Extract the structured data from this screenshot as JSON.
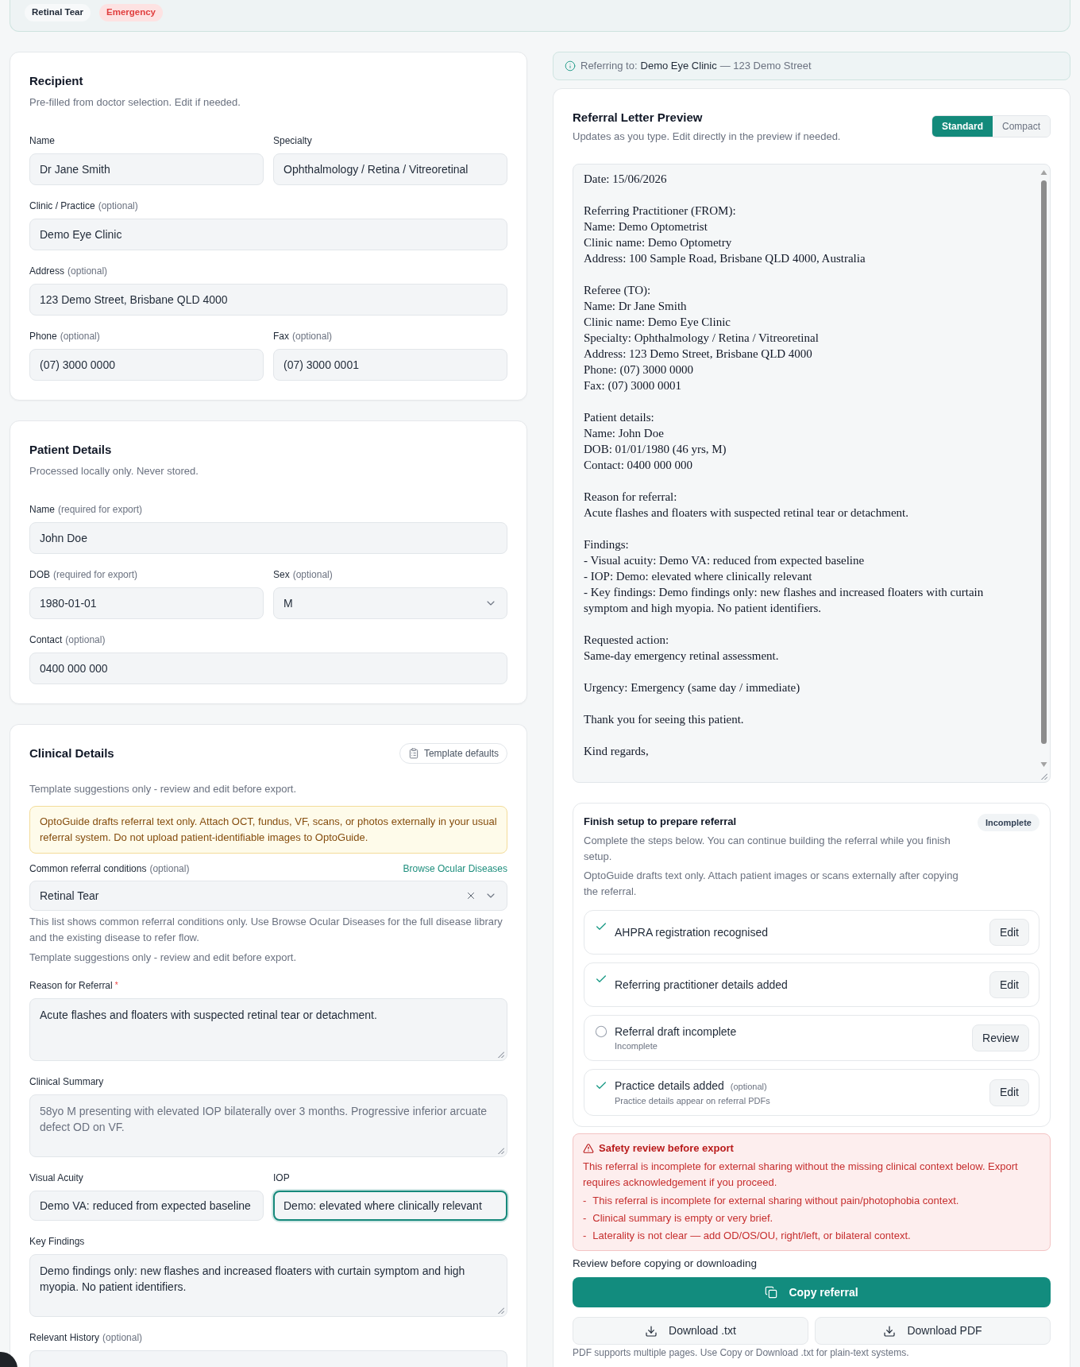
{
  "top_bar": {
    "tags": [
      {
        "kind": "condition",
        "label": "Retinal Tear"
      },
      {
        "kind": "urgency",
        "label": "Emergency"
      }
    ]
  },
  "recipient": {
    "title": "Recipient",
    "subtitle": "Pre-filled from doctor selection. Edit if needed.",
    "rows": [
      [
        {
          "kind": "text",
          "label": "Name",
          "value": "Dr Jane Smith"
        },
        {
          "kind": "text",
          "label": "Specialty",
          "value": "Ophthalmology / Retina / Vitreoretinal"
        }
      ],
      [
        {
          "kind": "text",
          "label": "Clinic / Practice",
          "hint": "(optional)",
          "value": "Demo Eye Clinic"
        }
      ],
      [
        {
          "kind": "text",
          "label": "Address",
          "hint": "(optional)",
          "value": "123 Demo Street, Brisbane QLD 4000"
        }
      ],
      [
        {
          "kind": "text",
          "label": "Phone",
          "hint": "(optional)",
          "value": "(07) 3000 0000"
        },
        {
          "kind": "text",
          "label": "Fax",
          "hint": "(optional)",
          "value": "(07) 3000 0001"
        }
      ]
    ]
  },
  "patient": {
    "title": "Patient Details",
    "subtitle": "Processed locally only. Never stored.",
    "rows": [
      [
        {
          "kind": "text",
          "label": "Name",
          "hint": "(required for export)",
          "value": "John Doe"
        }
      ],
      [
        {
          "kind": "text",
          "label": "DOB",
          "hint": "(required for export)",
          "value": "1980-01-01"
        },
        {
          "kind": "select",
          "label": "Sex",
          "hint": "(optional)",
          "value": "M"
        }
      ],
      [
        {
          "kind": "text",
          "label": "Contact",
          "hint": "(optional)",
          "value": "0400 000 000"
        }
      ]
    ]
  },
  "clinical": {
    "title": "Clinical Details",
    "defaults_button": "Template defaults",
    "subtitle": "Template suggestions only - review and edit before export.",
    "notice": "OptoGuide drafts referral text only. Attach OCT, fundus, VF, scans, or photos externally in your usual referral system. Do not upload patient-identifiable images to OptoGuide.",
    "condition": {
      "label": "Common referral conditions",
      "hint": "(optional)",
      "link": "Browse Ocular Diseases",
      "value": "Retinal Tear",
      "help": "This list shows common referral conditions only. Use Browse Ocular Diseases for the full disease library and the existing disease to refer flow.",
      "note": "Template suggestions only - review and edit before export."
    },
    "rows": [
      [
        {
          "kind": "textarea",
          "label": "Reason for Referral",
          "required_mark": "*",
          "value": "Acute flashes and floaters with suspected retinal tear or detachment.",
          "focused": false
        }
      ],
      [
        {
          "kind": "textarea",
          "label": "Clinical Summary",
          "placeholder": "58yo M presenting with elevated IOP bilaterally over 3 months. Progressive inferior arcuate defect OD on VF.",
          "focused": false
        }
      ],
      [
        {
          "kind": "text",
          "label": "Visual Acuity",
          "value": "Demo VA: reduced from expected baseline",
          "focused": false
        },
        {
          "kind": "text",
          "label": "IOP",
          "value": "Demo: elevated where clinically relevant",
          "focused": true
        }
      ],
      [
        {
          "kind": "textarea",
          "label": "Key Findings",
          "value": "Demo findings only: new flashes and increased floaters with curtain symptom and high myopia. No patient identifiers.",
          "focused": false
        }
      ],
      [
        {
          "kind": "text",
          "label": "Relevant History",
          "hint": "(optional)",
          "focused": false
        }
      ]
    ]
  },
  "banner": {
    "label": "Referring to:",
    "clinic": "Demo Eye Clinic",
    "address": "— 123 Demo Street"
  },
  "preview": {
    "title": "Referral Letter Preview",
    "subtitle": "Updates as you type. Edit directly in the preview if needed.",
    "modes": [
      {
        "label": "Standard",
        "selected": true
      },
      {
        "label": "Compact",
        "selected": false
      }
    ],
    "letter": [
      [
        "Date: 15/06/2026"
      ],
      [
        "Referring Practitioner (FROM):",
        "Name: Demo Optometrist",
        "Clinic name: Demo Optometry",
        "Address: 100 Sample Road, Brisbane QLD 4000, Australia"
      ],
      [
        "Referee (TO):",
        "Name: Dr Jane Smith",
        "Clinic name: Demo Eye Clinic",
        "Specialty: Ophthalmology / Retina / Vitreoretinal",
        "Address: 123 Demo Street, Brisbane QLD 4000",
        "Phone: (07) 3000 0000",
        "Fax: (07) 3000 0001"
      ],
      [
        "Patient details:",
        "Name: John Doe",
        "DOB: 01/01/1980 (46 yrs, M)",
        "Contact: 0400 000 000"
      ],
      [
        "Reason for referral:",
        "Acute flashes and floaters with suspected retinal tear or detachment."
      ],
      [
        "Findings:",
        "- Visual acuity: Demo VA: reduced from expected baseline",
        "- IOP: Demo: elevated where clinically relevant",
        "- Key findings: Demo findings only: new flashes and increased floaters with curtain symptom and high myopia. No patient identifiers."
      ],
      [
        "Requested action:",
        "Same-day emergency retinal assessment."
      ],
      [
        "Urgency: Emergency (same day / immediate)"
      ],
      [
        "Thank you for seeing this patient."
      ],
      [
        "Kind regards,"
      ]
    ]
  },
  "setup": {
    "title": "Finish setup to prepare referral",
    "status": "Incomplete",
    "description": "Complete the steps below. You can continue building the referral while you finish setup.",
    "note": "OptoGuide drafts text only. Attach patient images or scans externally after copying the referral.",
    "steps": [
      {
        "label": "AHPRA registration recognised",
        "complete": true,
        "action": "Edit"
      },
      {
        "label": "Referring practitioner details added",
        "complete": true,
        "action": "Edit"
      },
      {
        "label": "Referral draft incomplete",
        "complete": false,
        "detail": "Incomplete",
        "action": "Review"
      },
      {
        "label": "Practice details added",
        "hint": "(optional)",
        "complete": true,
        "detail": "Practice details appear on referral PDFs",
        "action": "Edit"
      }
    ]
  },
  "safety": {
    "title": "Safety review before export",
    "message": "This referral is incomplete for external sharing without the missing clinical context below. Export requires acknowledgement if you proceed.",
    "issues": [
      {
        "marker": "-",
        "text": "This referral is incomplete for external sharing without pain/photophobia context."
      },
      {
        "marker": "-",
        "text": "Clinical summary is empty or very brief."
      },
      {
        "marker": "-",
        "text": "Laterality is not clear — add OD/OS/OU, right/left, or bilateral context."
      }
    ]
  },
  "export": {
    "prompt": "Review before copying or downloading",
    "primary": "Copy referral",
    "downloads": [
      "Download .txt",
      "Download PDF"
    ],
    "footnote": "PDF supports multiple pages. Use Copy or Download .txt for plain-text systems."
  }
}
